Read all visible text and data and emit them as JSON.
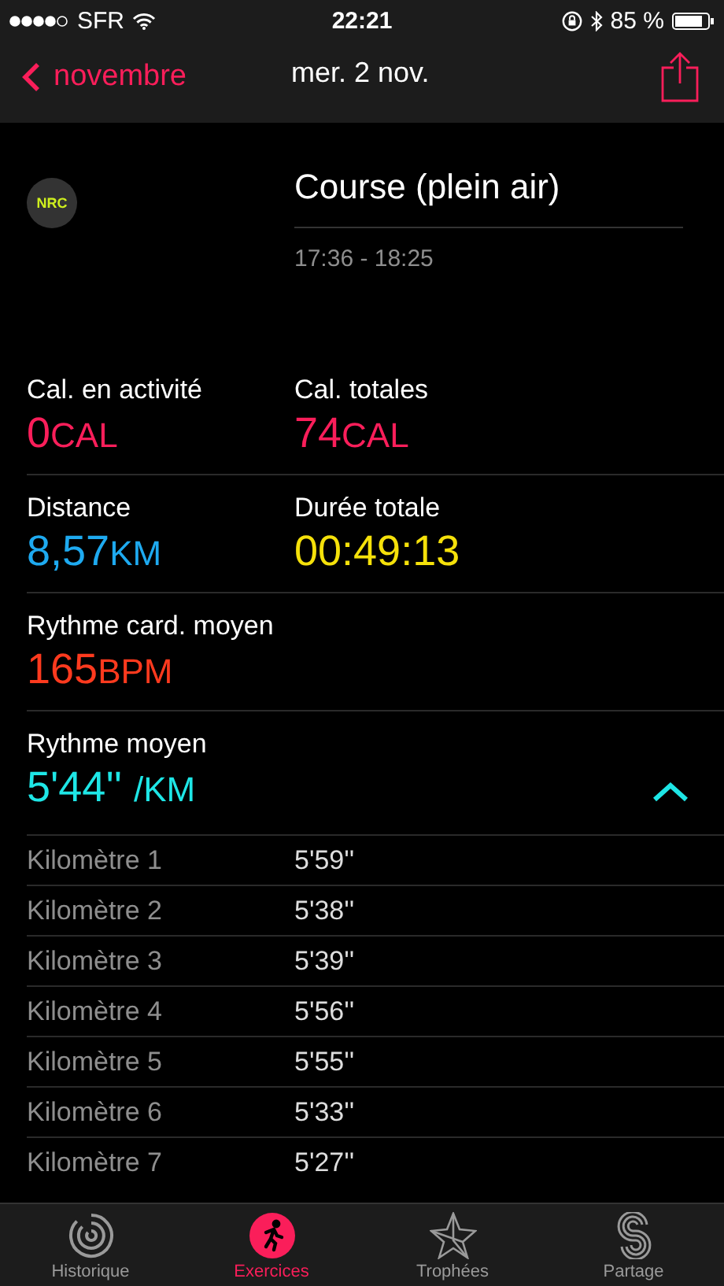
{
  "status_bar": {
    "carrier": "SFR",
    "time": "22:21",
    "battery": "85 %"
  },
  "nav": {
    "back": "novembre",
    "title": "mer. 2 nov."
  },
  "workout": {
    "app_badge": "NRC",
    "title": "Course (plein air)",
    "time_range": "17:36 - 18:25"
  },
  "metric_rows": [
    [
      {
        "label": "Cal. en activité",
        "value": "0",
        "unit": "CAL",
        "color": "#fa1e5a"
      },
      {
        "label": "Cal. totales",
        "value": "74",
        "unit": "CAL",
        "color": "#fa1e5a"
      }
    ],
    [
      {
        "label": "Distance",
        "value": "8,57",
        "unit": "KM",
        "color": "#1eaaf0"
      },
      {
        "label": "Durée totale",
        "value": "00:49:13",
        "color": "#f5e10a"
      }
    ],
    [
      {
        "label": "Rythme card. moyen",
        "value": "165",
        "unit": "BPM",
        "color": "#ff3a1e"
      }
    ]
  ],
  "pace": {
    "label": "Rythme moyen",
    "value": "5'44''",
    "unit": "/KM",
    "color": "#1ee6e6",
    "expanded": true
  },
  "splits": [
    {
      "name": "Kilomètre 1",
      "time": "5'59''"
    },
    {
      "name": "Kilomètre 2",
      "time": "5'38''"
    },
    {
      "name": "Kilomètre 3",
      "time": "5'39''"
    },
    {
      "name": "Kilomètre 4",
      "time": "5'56''"
    },
    {
      "name": "Kilomètre 5",
      "time": "5'55''"
    },
    {
      "name": "Kilomètre 6",
      "time": "5'33''"
    },
    {
      "name": "Kilomètre 7",
      "time": "5'27''"
    }
  ],
  "tabs": [
    {
      "kind": "history",
      "label": "Historique",
      "selected": false
    },
    {
      "kind": "workouts",
      "label": "Exercices",
      "selected": true
    },
    {
      "kind": "awards",
      "label": "Trophées",
      "selected": false
    },
    {
      "kind": "sharing",
      "label": "Partage",
      "selected": false
    }
  ]
}
